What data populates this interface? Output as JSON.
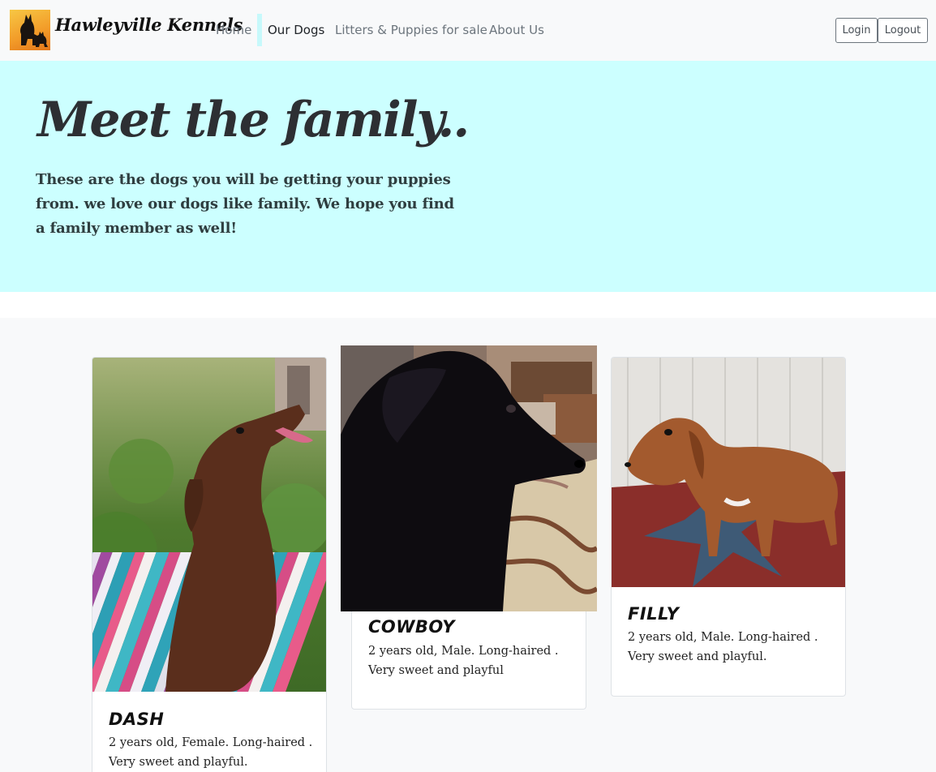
{
  "brand": {
    "name": "Hawleyville Kennels",
    "logo": "dog-silhouettes-logo"
  },
  "nav": {
    "home": "Home",
    "our_dogs": "Our Dogs",
    "litters": "Litters & Puppies for sale",
    "about": "About Us",
    "active": "Our Dogs"
  },
  "auth": {
    "login": "Login",
    "logout": "Logout"
  },
  "hero": {
    "title": "Meet the family..",
    "text": "These are the dogs you will be getting your puppies from. we love our dogs like family. We hope you find a family member as well!"
  },
  "dogs": [
    {
      "name": "DASH",
      "desc_line1": "2 years old, Female. Long-haired .",
      "desc_line2": "Very sweet and playful."
    },
    {
      "name": "COWBOY",
      "desc_line1": "2 years old, Male. Long-haired .",
      "desc_line2": "Very sweet and playful"
    },
    {
      "name": "FILLY",
      "desc_line1": "2 years old, Male. Long-haired .",
      "desc_line2": "Very sweet and playful."
    }
  ],
  "colors": {
    "hero_bg": "#ccffff",
    "navbar_bg": "#f8f9fa",
    "active_indicator": "#c7f9fb"
  }
}
